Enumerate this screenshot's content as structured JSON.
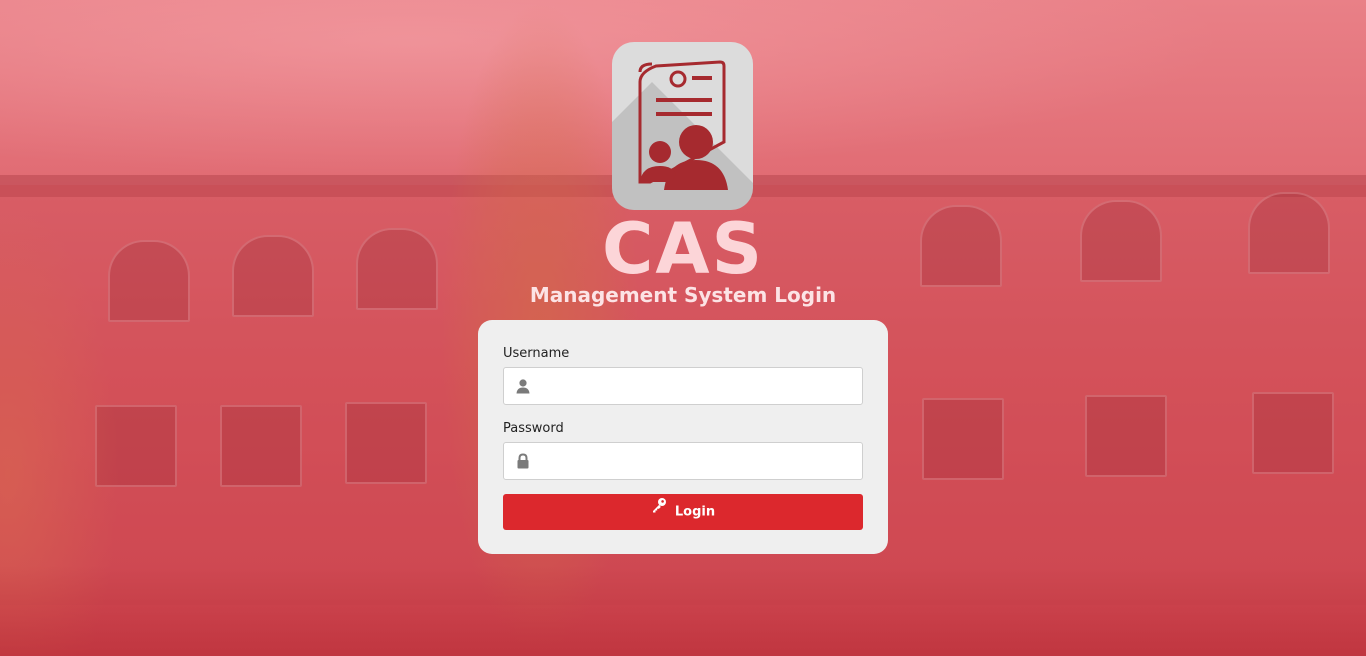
{
  "app": {
    "logo_icon": "document-users-icon",
    "title": "CAS",
    "subtitle": "Management System Login"
  },
  "form": {
    "username_label": "Username",
    "username_value": "",
    "username_placeholder": "",
    "username_icon": "user-icon",
    "password_label": "Password",
    "password_value": "",
    "password_placeholder": "",
    "password_icon": "lock-icon",
    "login_label": "Login",
    "login_icon": "key-icon"
  },
  "colors": {
    "accent": "#dc282d",
    "logo_red": "#a62a2f",
    "title_pink": "#fcd5d8"
  }
}
